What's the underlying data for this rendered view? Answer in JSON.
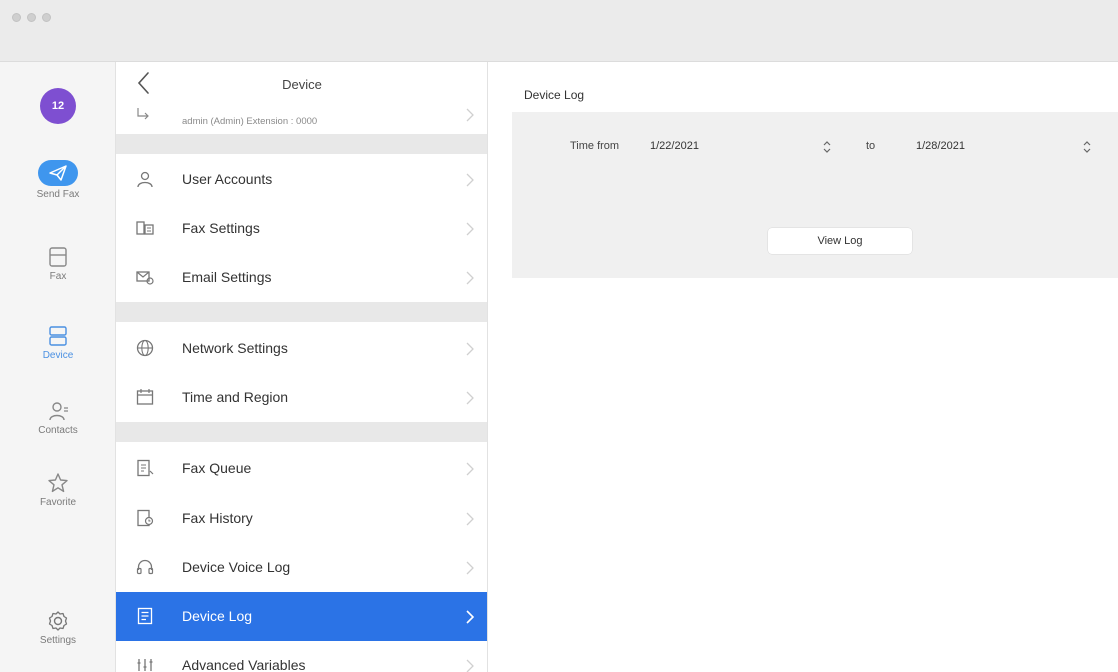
{
  "window": {
    "title": ""
  },
  "rail": {
    "avatar_text": "12",
    "items": [
      {
        "label": "Send Fax",
        "icon": "send-fax-icon"
      },
      {
        "label": "Fax",
        "icon": "inbox-icon"
      },
      {
        "label": "Device",
        "icon": "device-icon"
      },
      {
        "label": "Contacts",
        "icon": "contacts-icon"
      },
      {
        "label": "Favorite",
        "icon": "star-icon"
      },
      {
        "label": "Settings",
        "icon": "gear-icon"
      }
    ],
    "active_index": 2,
    "accent_color": "#3f96ee"
  },
  "middle": {
    "title": "Device",
    "user_line": "admin (Admin)   Extension : 0000",
    "menu": [
      {
        "label": "User Accounts",
        "icon": "user-accounts-icon"
      },
      {
        "label": "Fax Settings",
        "icon": "fax-settings-icon"
      },
      {
        "label": "Email Settings",
        "icon": "email-settings-icon"
      },
      {
        "label": "Network Settings",
        "icon": "globe-icon"
      },
      {
        "label": "Time and Region",
        "icon": "calendar-icon"
      },
      {
        "label": "Fax Queue",
        "icon": "fax-queue-icon"
      },
      {
        "label": "Fax History",
        "icon": "fax-history-icon"
      },
      {
        "label": "Device Voice Log",
        "icon": "headset-icon"
      },
      {
        "label": "Device Log",
        "icon": "log-icon"
      },
      {
        "label": "Advanced Variables",
        "icon": "variables-icon"
      }
    ],
    "selected_label": "Device Log",
    "selected_color": "#2b73e6"
  },
  "detail": {
    "title": "Device Log",
    "time_from_label": "Time from",
    "from_date": "1/22/2021",
    "to_label": "to",
    "to_date": "1/28/2021",
    "view_log_button": "View Log"
  }
}
